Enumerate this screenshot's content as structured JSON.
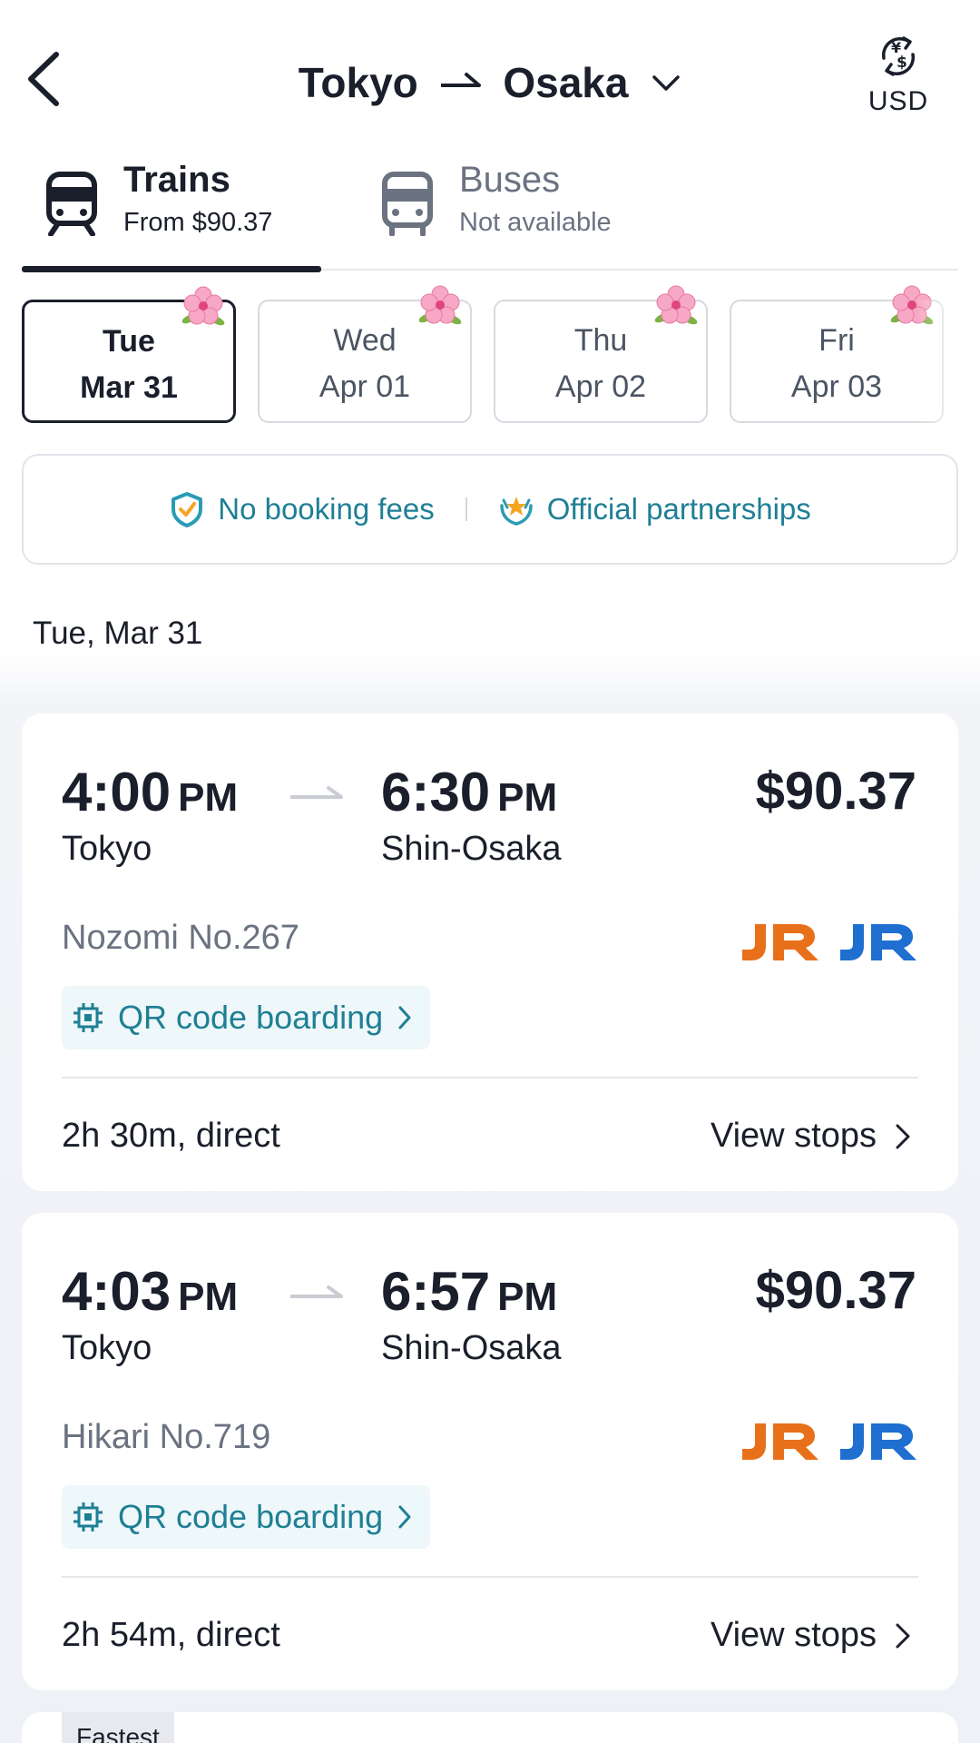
{
  "header": {
    "origin": "Tokyo",
    "destination": "Osaka",
    "currency": "USD"
  },
  "tabs": [
    {
      "label": "Trains",
      "sub": "From $90.37",
      "active": true
    },
    {
      "label": "Buses",
      "sub": "Not available",
      "active": false
    }
  ],
  "dates": [
    {
      "dow": "Tue",
      "dm": "Mar 31",
      "selected": true
    },
    {
      "dow": "Wed",
      "dm": "Apr 01",
      "selected": false
    },
    {
      "dow": "Thu",
      "dm": "Apr 02",
      "selected": false
    },
    {
      "dow": "Fri",
      "dm": "Apr 03",
      "selected": false
    }
  ],
  "banner": {
    "item1": "No booking fees",
    "item2": "Official partnerships"
  },
  "date_heading": "Tue, Mar 31",
  "trips": [
    {
      "dep_time": "4:00",
      "dep_ampm": "PM",
      "arr_time": "6:30",
      "arr_ampm": "PM",
      "price": "$90.37",
      "dep_station": "Tokyo",
      "arr_station": "Shin-Osaka",
      "train": "Nozomi No.267",
      "boarding": "QR code boarding",
      "duration": "2h 30m, direct",
      "view_stops": "View stops"
    },
    {
      "dep_time": "4:03",
      "dep_ampm": "PM",
      "arr_time": "6:57",
      "arr_ampm": "PM",
      "price": "$90.37",
      "dep_station": "Tokyo",
      "arr_station": "Shin-Osaka",
      "train": "Hikari No.719",
      "boarding": "QR code boarding",
      "duration": "2h 54m, direct",
      "view_stops": "View stops"
    }
  ],
  "third_card_badge": "Fastest",
  "colors": {
    "teal": "#1f7f95",
    "jr_orange": "#e8701a",
    "jr_blue": "#1e6fd0",
    "dark": "#1a1f2b"
  },
  "icons": {
    "back": "back-icon",
    "currency": "currency-exchange-icon",
    "train": "train-icon",
    "bus": "bus-icon",
    "flower": "cherry-blossom-icon",
    "shield": "shield-check-icon",
    "partnership": "partnership-icon",
    "qr": "qr-chip-icon"
  }
}
